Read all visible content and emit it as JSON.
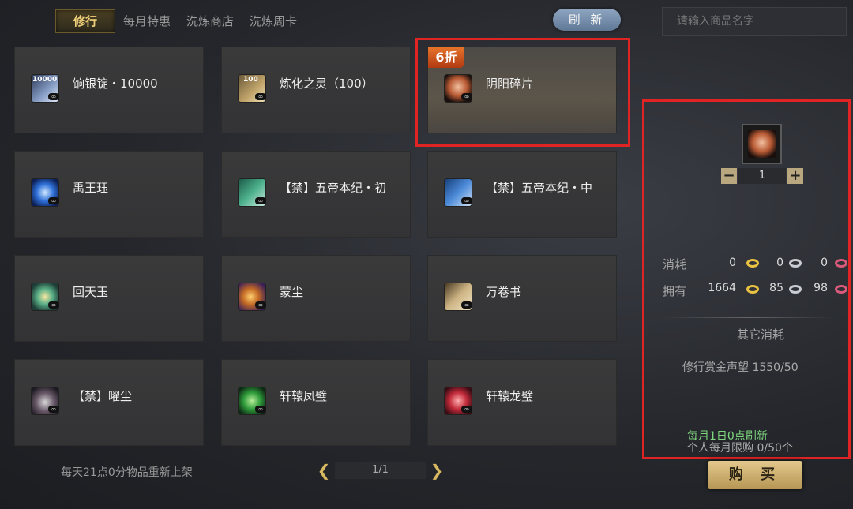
{
  "tabs": [
    {
      "label": "修行",
      "active": true
    },
    {
      "label": "每月特惠",
      "active": false
    },
    {
      "label": "洗炼商店",
      "active": false
    },
    {
      "label": "洗炼周卡",
      "active": false
    }
  ],
  "refresh_label": "刷 新",
  "search": {
    "placeholder": "请输入商品名字"
  },
  "items": [
    {
      "name": "饷银锭・10000",
      "icon": "silver-ingot-icon",
      "icon_text": "10000",
      "unlimited": "∞"
    },
    {
      "name": "炼化之灵（100）",
      "icon": "refine-spirit-icon",
      "icon_text": "100",
      "unlimited": "∞"
    },
    {
      "name": "阴阳碎片",
      "icon": "yinyang-shard-icon",
      "discount": "6折",
      "selected": true,
      "unlimited": "∞"
    },
    {
      "name": "禹王珏",
      "icon": "yuwang-jade-icon",
      "unlimited": "∞"
    },
    {
      "name": "【禁】五帝本纪・初",
      "icon": "green-book-icon",
      "unlimited": "∞"
    },
    {
      "name": "【禁】五帝本纪・中",
      "icon": "blue-book-icon",
      "unlimited": "∞"
    },
    {
      "name": "回天玉",
      "icon": "huitian-jade-icon",
      "unlimited": "∞"
    },
    {
      "name": "蒙尘",
      "icon": "dust-orb-icon",
      "unlimited": "∞"
    },
    {
      "name": "万卷书",
      "icon": "scroll-icon",
      "unlimited": "∞"
    },
    {
      "name": "【禁】曜尘",
      "icon": "forbidden-dust-icon",
      "unlimited": "∞"
    },
    {
      "name": "轩辕凤璧",
      "icon": "phoenix-jade-icon",
      "unlimited": "∞"
    },
    {
      "name": "轩辕龙璧",
      "icon": "dragon-jade-icon",
      "unlimited": "∞"
    }
  ],
  "restock_note": "每天21点0分物品重新上架",
  "pager": {
    "text": "1/1",
    "prev": "❮",
    "next": "❯"
  },
  "detail": {
    "quantity": "1",
    "minus": "−",
    "plus": "+",
    "cost_label": "消耗",
    "own_label": "拥有",
    "cost": [
      "0",
      "0",
      "0"
    ],
    "own": [
      "1664",
      "85",
      "98"
    ],
    "other_cost_label": "其它消耗",
    "reputation": "修行赏金声望  1550/50",
    "monthly_refresh": "每月1日0点刷新",
    "limit": "个人每月限购  0/50个",
    "buy_label": "购 买"
  },
  "colors": {
    "gold": "#e8c240",
    "silver": "#c9ccd2",
    "pink": "#d85a7a",
    "highlight": "#e02424"
  }
}
